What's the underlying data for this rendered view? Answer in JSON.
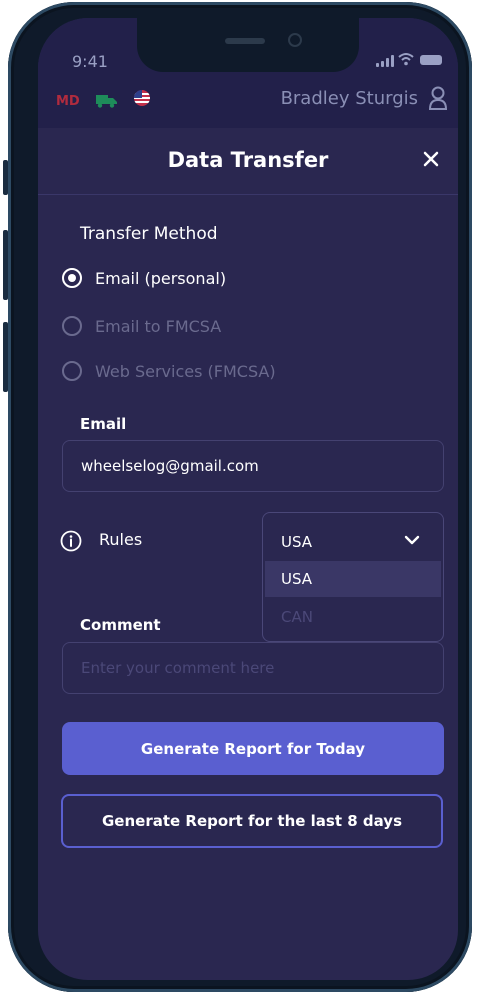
{
  "status_bar": {
    "time": "9:41"
  },
  "top_bar": {
    "badge": "MD",
    "user_name": "Bradley Sturgis",
    "icons": [
      "truck-icon",
      "us-flag-icon",
      "user-icon"
    ]
  },
  "header": {
    "title": "Data Transfer",
    "close_icon": "close-icon"
  },
  "transfer_method": {
    "label": "Transfer Method",
    "options": [
      {
        "label": "Email (personal)",
        "selected": true
      },
      {
        "label": "Email to FMCSA",
        "selected": false
      },
      {
        "label": "Web Services (FMCSA)",
        "selected": false
      }
    ]
  },
  "email": {
    "label": "Email",
    "value": "wheelselog@gmail.com"
  },
  "rules": {
    "label": "Rules",
    "selected": "USA",
    "options": [
      "USA",
      "CAN"
    ]
  },
  "comment": {
    "label": "Comment",
    "placeholder": "Enter your comment here"
  },
  "buttons": {
    "today": "Generate Report for Today",
    "last_days": "Generate Report for the last 8 days"
  },
  "colors": {
    "background": "#2a2750",
    "top_bar": "#22204a",
    "accent": "#5a5fd0",
    "muted_text": "#6a6a8e"
  }
}
